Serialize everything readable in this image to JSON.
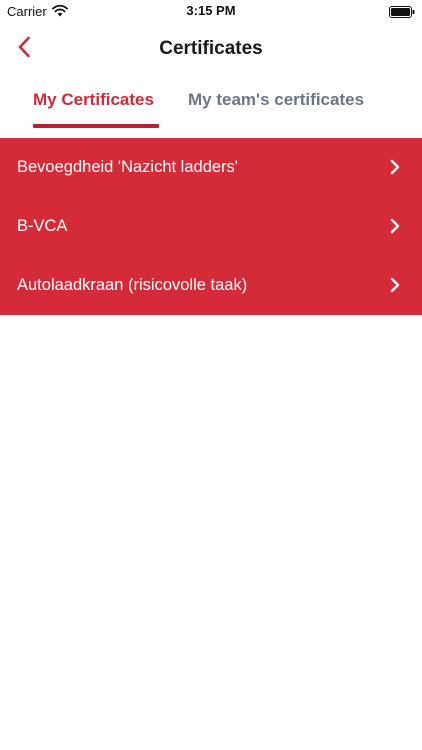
{
  "status_bar": {
    "carrier": "Carrier",
    "time": "3:15 PM",
    "wifi_icon": "wifi-icon",
    "battery_icon": "battery-icon"
  },
  "nav": {
    "back_icon": "chevron-left-icon",
    "title": "Certificates"
  },
  "tabs": [
    {
      "label": "My Certificates",
      "active": true
    },
    {
      "label": "My team's certificates",
      "active": false
    }
  ],
  "certificates": [
    {
      "label": "Bevoegdheid 'Nazicht ladders'"
    },
    {
      "label": "B-VCA"
    },
    {
      "label": "Autolaadkraan (risicovolle taak)"
    }
  ],
  "colors": {
    "accent": "#cf2a37",
    "list_background": "#d52b38",
    "inactive_tab": "#6b7784"
  }
}
